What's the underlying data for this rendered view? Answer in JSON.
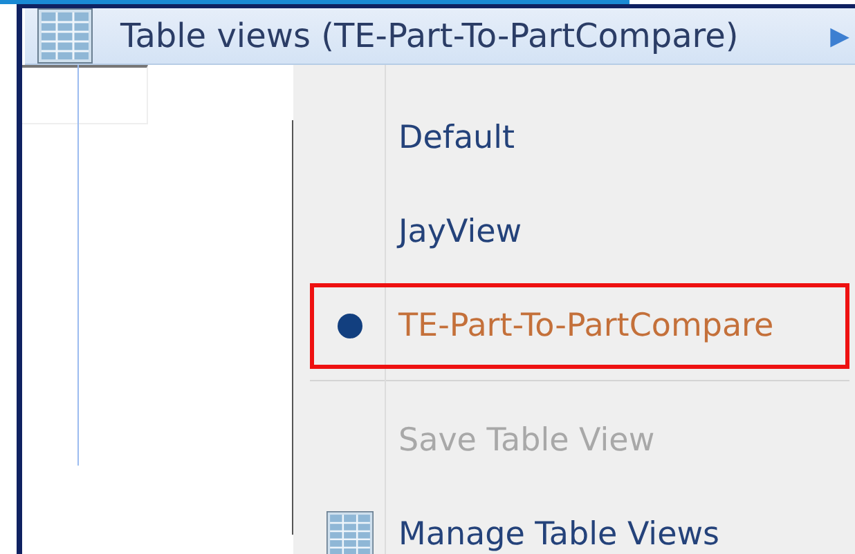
{
  "header": {
    "title": "Table views (TE-Part-To-PartCompare)",
    "arrow": "▶"
  },
  "menu": {
    "items": [
      {
        "kind": "radio",
        "label": "Default",
        "selected": false,
        "highlighted": false
      },
      {
        "kind": "radio",
        "label": "JayView",
        "selected": false,
        "highlighted": false
      },
      {
        "kind": "radio",
        "label": "TE-Part-To-PartCompare",
        "selected": true,
        "highlighted": true
      },
      {
        "kind": "separator"
      },
      {
        "kind": "command",
        "label": "Save Table View",
        "disabled": true
      },
      {
        "kind": "icon",
        "label": "Manage Table Views",
        "disabled": false
      }
    ]
  }
}
